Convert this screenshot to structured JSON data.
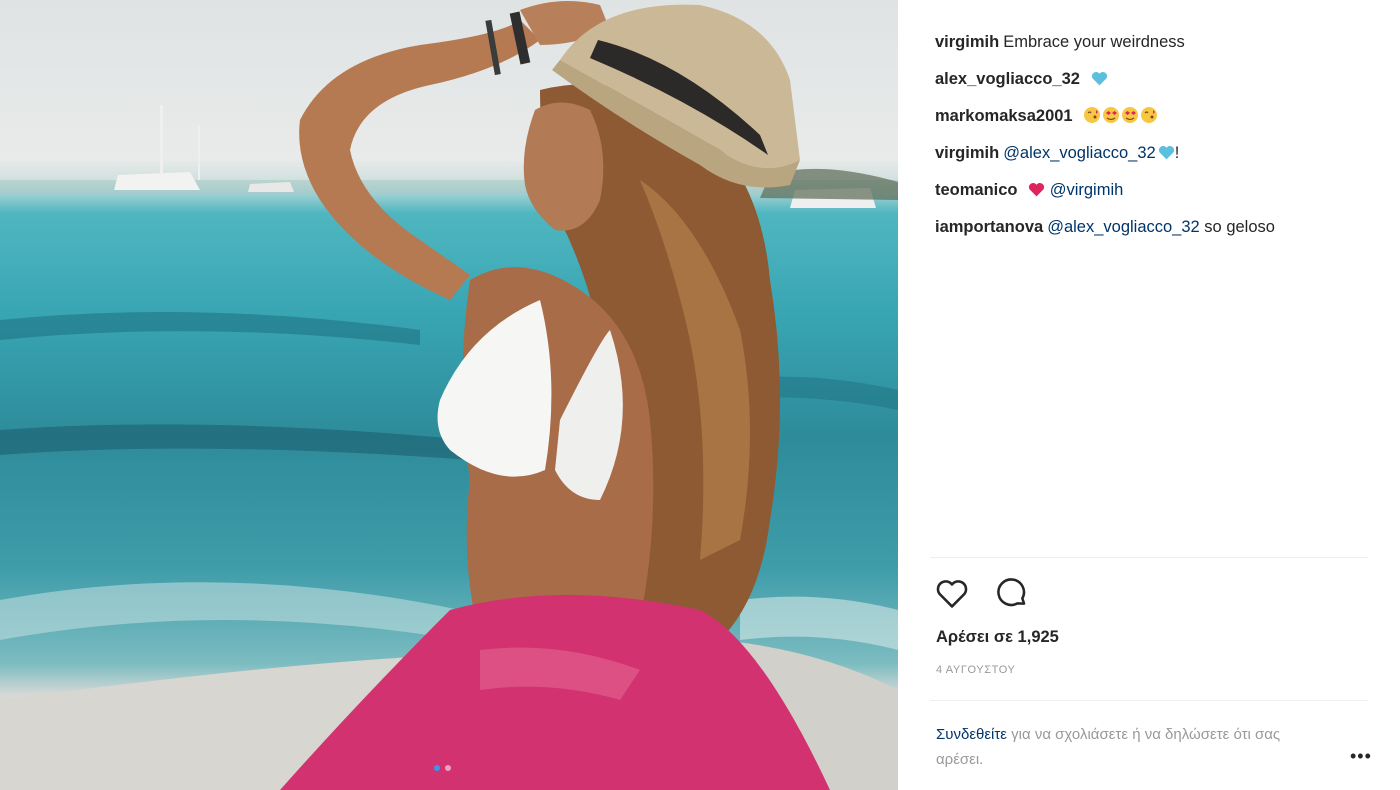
{
  "post": {
    "caption_user": "virgimih",
    "caption_text": "Embrace your weirdness",
    "comments": [
      {
        "user": "alex_vogliacco_32",
        "pre": "",
        "mention": "",
        "post": "",
        "emoji": "blue-heart"
      },
      {
        "user": "markomaksa2001",
        "pre": "",
        "mention": "",
        "post": "",
        "emoji": "kiss-heart-eyes"
      },
      {
        "user": "virgimih",
        "pre": "",
        "mention": "@alex_vogliacco_32",
        "post": "!",
        "emoji": "blue-heart"
      },
      {
        "user": "teomanico",
        "pre": "",
        "mention": "@virgimih",
        "post": "",
        "emoji": "red-heart"
      },
      {
        "user": "iamportanova",
        "pre": "",
        "mention": "@alex_vogliacco_32",
        "post": " so geloso",
        "emoji": ""
      }
    ],
    "likes_label": "Αρέσει σε 1,925",
    "date_label": "4 ΑΥΓΟΥΣΤΟΥ",
    "login_link": "Συνδεθείτε",
    "login_text": " για να σχολιάσετε ή να δηλώσετε ότι σας αρέσει.",
    "more_label": "•••",
    "carousel": {
      "count": 2,
      "active": 0
    }
  },
  "icons": {
    "like": "heart-outline-icon",
    "comment": "comment-bubble-icon"
  },
  "colors": {
    "username": "#262626",
    "mention": "#003569",
    "meta": "#999999",
    "blue_heart": "#5bc0de",
    "red_heart": "#e0245e"
  }
}
